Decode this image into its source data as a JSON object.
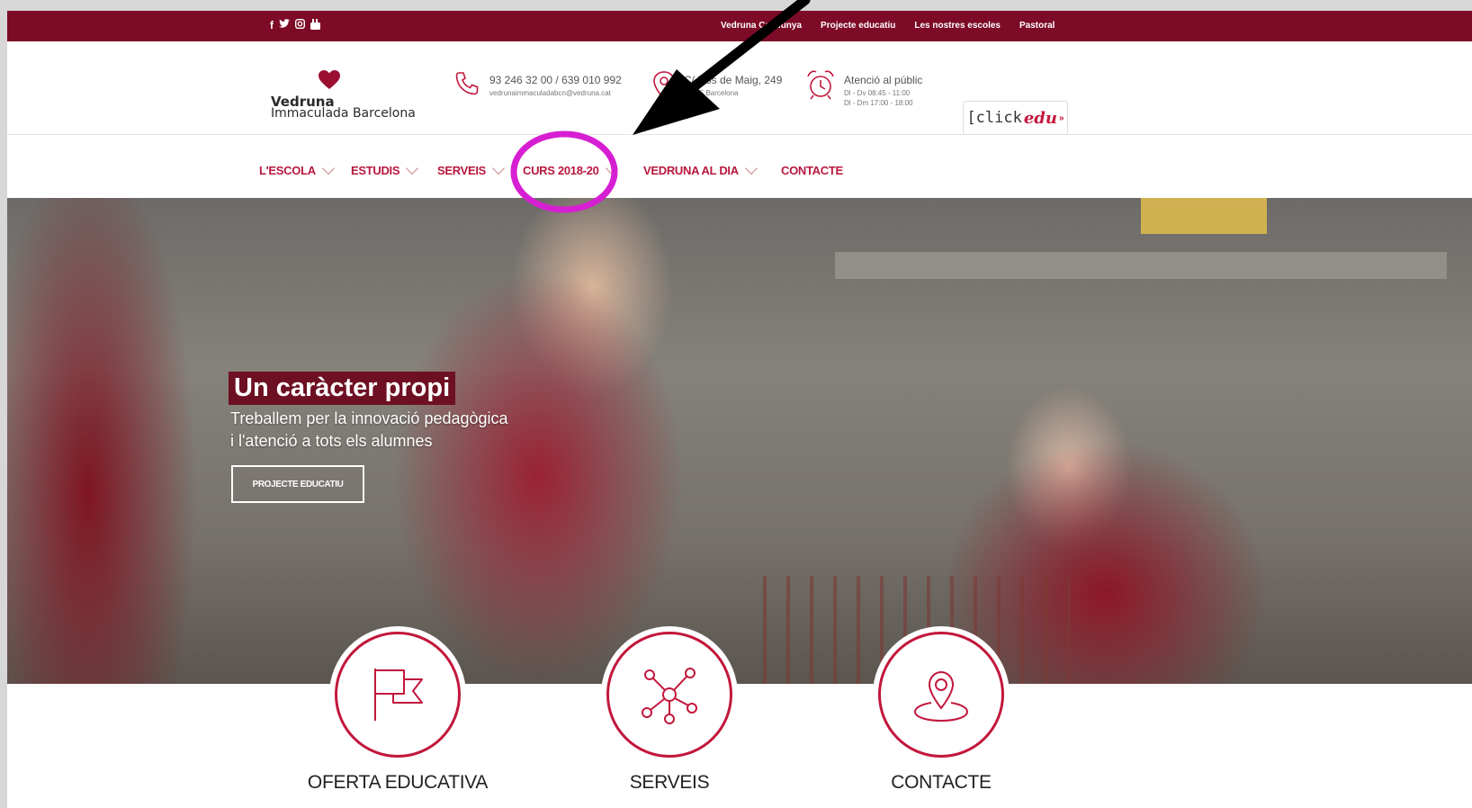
{
  "topbar": {
    "social_icons": [
      "facebook-icon",
      "twitter-icon",
      "instagram-icon",
      "youtube-icon"
    ],
    "links": [
      "Vedruna Catalunya",
      "Projecte educatiu",
      "Les nostres escoles",
      "Pastoral"
    ]
  },
  "header": {
    "logo_line1": "Vedruna",
    "logo_line2": "Immaculada Barcelona",
    "phone": "93 246 32 00 / 639 010 992",
    "email": "vedrunaimmaculadabcn@vedruna.cat",
    "address_line1": "C/ Dos de Maig, 249",
    "address_line2": "08025 Barcelona",
    "hours_title": "Atenció al públic",
    "hours_line1": "Dl - Dv 08:45 - 11:00",
    "hours_line2": "Dl - Dm 17:00 - 18:00",
    "clickedu_part1": "[click",
    "clickedu_part2": "edu",
    "clickedu_part3": "»"
  },
  "nav": {
    "items": [
      {
        "label": "L'ESCOLA",
        "dropdown": true
      },
      {
        "label": "ESTUDIS",
        "dropdown": true
      },
      {
        "label": "SERVEIS",
        "dropdown": true
      },
      {
        "label": "CURS 2018-20",
        "dropdown": true
      },
      {
        "label": "VEDRUNA AL DIA",
        "dropdown": true
      },
      {
        "label": "CONTACTE",
        "dropdown": false
      }
    ]
  },
  "hero": {
    "title": "Un caràcter propi",
    "subtitle_line1": "Treballem per la innovació pedagògica",
    "subtitle_line2": "i l'atenció a tots els alumnes",
    "button": "PROJECTE EDUCATIU"
  },
  "features": [
    {
      "label": "OFERTA EDUCATIVA",
      "icon": "flag-icon"
    },
    {
      "label": "SERVEIS",
      "icon": "network-icon"
    },
    {
      "label": "CONTACTE",
      "icon": "location-pin-icon"
    }
  ],
  "colors": {
    "brand": "#7d0a27",
    "accent": "#c2173c",
    "annotation_circle": "#d61fd2",
    "annotation_arrow": "#000000"
  }
}
